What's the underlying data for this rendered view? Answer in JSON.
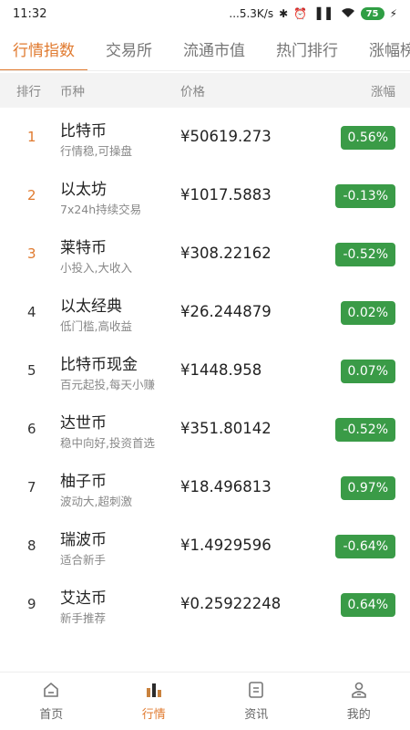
{
  "status_bar": {
    "time": "11:32",
    "network_speed": "...5.3K/s",
    "battery": "75",
    "icons": [
      "bluetooth-icon",
      "alarm-icon",
      "hd-signal-icon",
      "signal-icon",
      "wifi-icon",
      "battery-icon",
      "charging-icon"
    ]
  },
  "tabs": [
    {
      "label": "行情指数",
      "active": true
    },
    {
      "label": "交易所",
      "active": false
    },
    {
      "label": "流通市值",
      "active": false
    },
    {
      "label": "热门排行",
      "active": false
    },
    {
      "label": "涨幅榜",
      "active": false
    }
  ],
  "table_header": {
    "rank": "排行",
    "coin": "币种",
    "price": "价格",
    "change": "涨幅"
  },
  "rows": [
    {
      "rank": "1",
      "name": "比特币",
      "sub": "行情稳,可操盘",
      "price": "¥50619.273",
      "change": "0.56%"
    },
    {
      "rank": "2",
      "name": "以太坊",
      "sub": "7x24h持续交易",
      "price": "¥1017.5883",
      "change": "-0.13%"
    },
    {
      "rank": "3",
      "name": "莱特币",
      "sub": "小投入,大收入",
      "price": "¥308.22162",
      "change": "-0.52%"
    },
    {
      "rank": "4",
      "name": "以太经典",
      "sub": "低门槛,高收益",
      "price": "¥26.244879",
      "change": "0.02%"
    },
    {
      "rank": "5",
      "name": "比特币现金",
      "sub": "百元起投,每天小赚",
      "price": "¥1448.958",
      "change": "0.07%"
    },
    {
      "rank": "6",
      "name": "达世币",
      "sub": "稳中向好,投资首选",
      "price": "¥351.80142",
      "change": "-0.52%"
    },
    {
      "rank": "7",
      "name": "柚子币",
      "sub": "波动大,超刺激",
      "price": "¥18.496813",
      "change": "0.97%"
    },
    {
      "rank": "8",
      "name": "瑞波币",
      "sub": "适合新手",
      "price": "¥1.4929596",
      "change": "-0.64%"
    },
    {
      "rank": "9",
      "name": "艾达币",
      "sub": "新手推荐",
      "price": "¥0.25922248",
      "change": "0.64%"
    }
  ],
  "bottom_nav": [
    {
      "label": "首页",
      "icon": "home-icon",
      "active": false
    },
    {
      "label": "行情",
      "icon": "chart-icon",
      "active": true
    },
    {
      "label": "资讯",
      "icon": "news-icon",
      "active": false
    },
    {
      "label": "我的",
      "icon": "profile-icon",
      "active": false
    }
  ],
  "colors": {
    "accent": "#e07a2f",
    "badge_bg": "#3a9b47",
    "header_bg": "#f3f3f3"
  }
}
